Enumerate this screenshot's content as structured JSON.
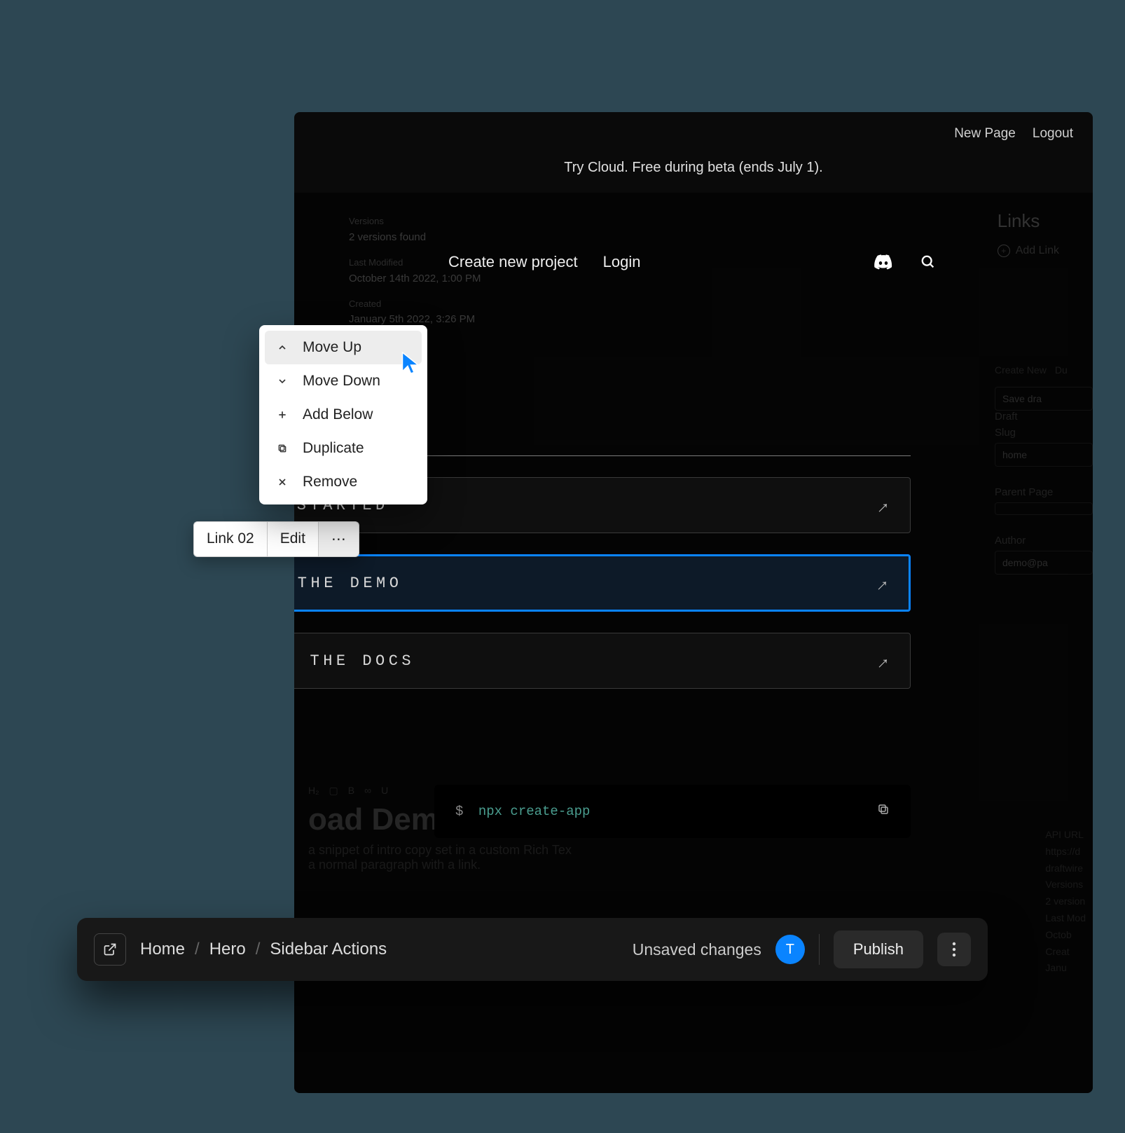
{
  "topbar": {
    "new_page": "New Page",
    "logout": "Logout"
  },
  "banner": "Try Cloud. Free during beta (ends July 1).",
  "faded_meta": {
    "versions_label": "Versions",
    "versions": "2 versions found",
    "modified_label": "Last Modified",
    "modified": "October 14th 2022, 1:00 PM",
    "created_label": "Created",
    "created": "January 5th 2022, 3:26 PM"
  },
  "header": {
    "create_project": "Create new project",
    "login": "Login"
  },
  "links_panel": {
    "title": "Links",
    "add": "Add Link"
  },
  "right_sidebar": {
    "create_new": "Create New",
    "duplicate_short": "Du",
    "save_label": "Save dra",
    "draft_label": "Draft",
    "slug_label": "Slug",
    "slug_value": "home",
    "parent_label": "Parent Page",
    "author_label": "Author",
    "author_value": "demo@pa"
  },
  "link_cards": [
    {
      "label": "GET STARTED"
    },
    {
      "label": "TRY THE DEMO"
    },
    {
      "label": "READ THE DOCS"
    }
  ],
  "context_menu": [
    {
      "icon": "chevron-up",
      "label": "Move Up"
    },
    {
      "icon": "chevron-down",
      "label": "Move Down"
    },
    {
      "icon": "plus",
      "label": "Add Below"
    },
    {
      "icon": "duplicate",
      "label": "Duplicate"
    },
    {
      "icon": "x",
      "label": "Remove"
    }
  ],
  "inline_toolbar": {
    "badge": "Link 02",
    "edit": "Edit",
    "more": "⋯"
  },
  "faded_richtext": {
    "heading": "oad Demo",
    "line1": "a snippet of intro copy set in a custom Rich Tex",
    "line2": "a normal paragraph with a link."
  },
  "code_block": {
    "prompt": "$",
    "command": "npx create-app"
  },
  "faded_bottom": {
    "url_label": "API URL",
    "url": "https://d",
    "slug": "draftwire",
    "versions_label": "Versions",
    "versions": "2 version",
    "modified_label": "Last Mod",
    "modified": "Octob",
    "created_label": "Creat",
    "created": "Janu"
  },
  "bottom_bar": {
    "breadcrumb": [
      "Home",
      "Hero",
      "Sidebar Actions"
    ],
    "unsaved": "Unsaved changes",
    "avatar_initial": "T",
    "publish": "Publish"
  }
}
